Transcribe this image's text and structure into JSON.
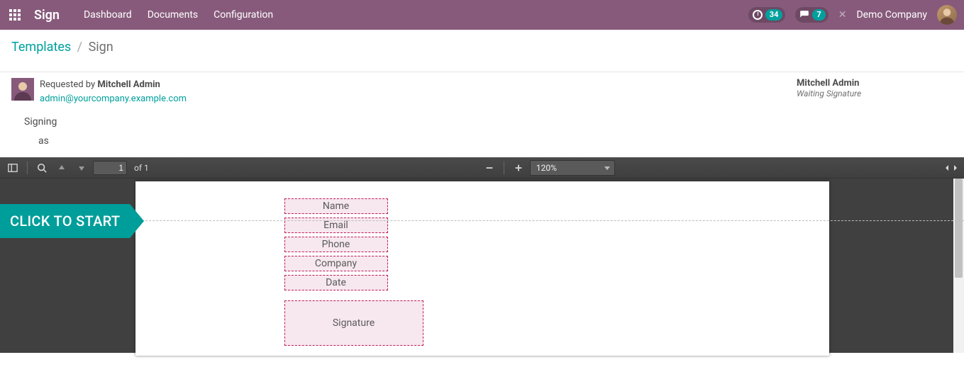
{
  "header": {
    "brand": "Sign",
    "menu": [
      "Dashboard",
      "Documents",
      "Configuration"
    ],
    "activity_count": "34",
    "messages_count": "7",
    "company": "Demo Company"
  },
  "breadcrumb": {
    "root": "Templates",
    "current": "Sign"
  },
  "request": {
    "prefix": "Requested by ",
    "author": "Mitchell Admin",
    "email": "admin@yourcompany.example.com",
    "signer_name": "Mitchell Admin",
    "signer_status": "Waiting Signature"
  },
  "signing": {
    "line1": "Signing",
    "line2": "as"
  },
  "pdf": {
    "page_input": "1",
    "page_total": "of 1",
    "zoom": "120%"
  },
  "cta": "CLICK TO START",
  "fields": {
    "items": [
      "Name",
      "Email",
      "Phone",
      "Company",
      "Date"
    ],
    "signature": "Signature"
  }
}
